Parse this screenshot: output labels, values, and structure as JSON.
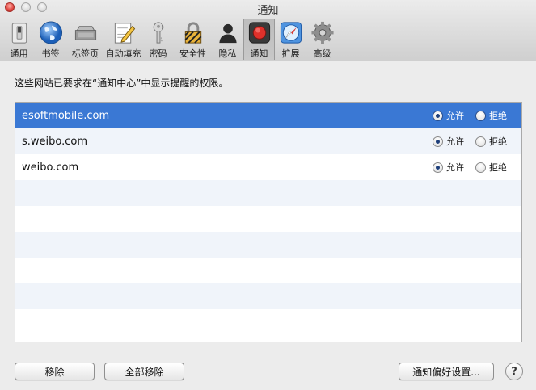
{
  "window": {
    "title": "通知"
  },
  "toolbar": {
    "items": [
      {
        "label": "通用",
        "icon": "general-switch-icon"
      },
      {
        "label": "书签",
        "icon": "globe-icon"
      },
      {
        "label": "标签页",
        "icon": "tabs-icon"
      },
      {
        "label": "自动填充",
        "icon": "pencil-form-icon"
      },
      {
        "label": "密码",
        "icon": "key-icon"
      },
      {
        "label": "安全性",
        "icon": "lock-icon"
      },
      {
        "label": "隐私",
        "icon": "person-silhouette-icon"
      },
      {
        "label": "通知",
        "icon": "notification-record-icon",
        "active": true
      },
      {
        "label": "扩展",
        "icon": "compass-icon"
      },
      {
        "label": "高级",
        "icon": "gear-icon"
      }
    ]
  },
  "description": "这些网站已要求在“通知中心”中显示提醒的权限。",
  "sites": [
    {
      "name": "esoftmobile.com",
      "allow_label": "允许",
      "deny_label": "拒绝",
      "setting": "allow",
      "selected": true
    },
    {
      "name": "s.weibo.com",
      "allow_label": "允许",
      "deny_label": "拒绝",
      "setting": "allow",
      "selected": false
    },
    {
      "name": "weibo.com",
      "allow_label": "允许",
      "deny_label": "拒绝",
      "setting": "allow",
      "selected": false
    }
  ],
  "empty_rows": 6,
  "buttons": {
    "remove": "移除",
    "remove_all": "全部移除",
    "notification_prefs": "通知偏好设置...",
    "help": "?"
  },
  "colors": {
    "selection": "#3a78d4",
    "stripe": "#f0f4fa"
  }
}
